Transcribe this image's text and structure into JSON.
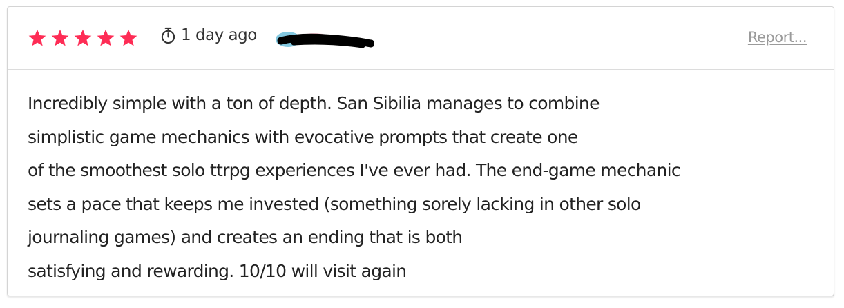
{
  "review": {
    "rating": 5,
    "rating_max": 5,
    "star_color": "#fe2c55",
    "time_ago": "1 day ago",
    "timer_icon": "stopwatch-icon",
    "reviewer_avatar": "redacted-avatar",
    "report_label": "Report...",
    "body_lines": [
      "Incredibly simple with a ton of depth. San Sibilia manages to combine",
      "simplistic game mechanics with evocative prompts that create one",
      "of the smoothest solo ttrpg experiences I've ever had. The end-game mechanic",
      "sets a pace that keeps me invested (something sorely lacking in other solo",
      "journaling games) and creates an ending that is both",
      "satisfying and rewarding. 10/10 will visit again"
    ]
  }
}
